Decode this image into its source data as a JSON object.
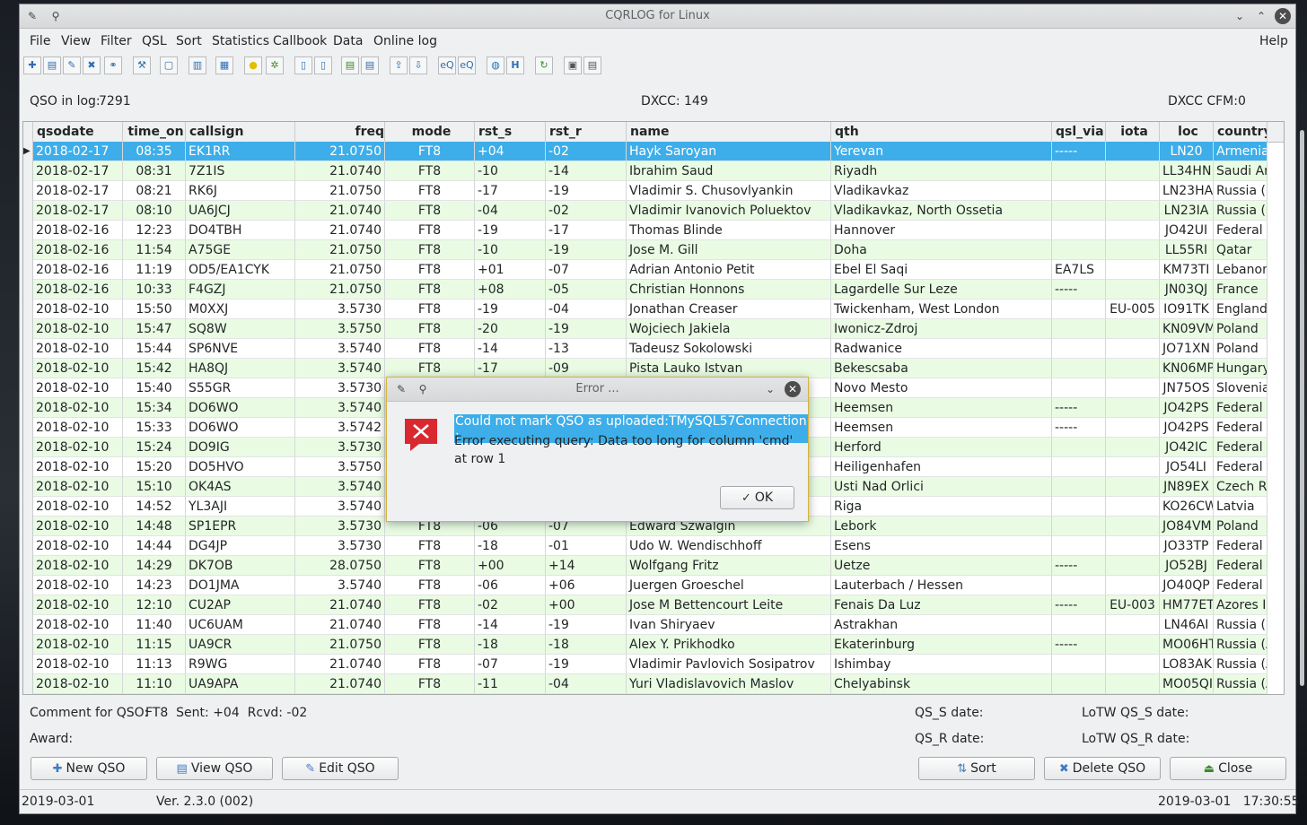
{
  "window": {
    "title": "CQRLOG for Linux"
  },
  "menu": [
    "File",
    "View",
    "Filter",
    "QSL",
    "Sort",
    "Statistics",
    "Callbook",
    "Data",
    "Online log"
  ],
  "menu_help": "Help",
  "stats": {
    "qso_label": "QSO in log:",
    "qso_value": "7291",
    "dxcc_label": "DXCC:",
    "dxcc_value": "149",
    "cfm_label": "DXCC CFM:",
    "cfm_value": "0"
  },
  "columns": [
    "qsodate",
    "time_on",
    "callsign",
    "freq",
    "mode",
    "rst_s",
    "rst_r",
    "name",
    "qth",
    "qsl_via",
    "iota",
    "loc",
    "country"
  ],
  "rows": [
    [
      "2018-02-17",
      "08:35",
      "EK1RR",
      "21.0750",
      "FT8",
      "+04",
      "-02",
      "Hayk Saroyan",
      "Yerevan",
      "-----",
      "",
      "LN20",
      "Armenia"
    ],
    [
      "2018-02-17",
      "08:31",
      "7Z1IS",
      "21.0740",
      "FT8",
      "-10",
      "-14",
      "Ibrahim Saud",
      "Riyadh",
      "",
      "",
      "LL34HN",
      "Saudi Arabia"
    ],
    [
      "2018-02-17",
      "08:21",
      "RK6J",
      "21.0750",
      "FT8",
      "-17",
      "-19",
      "Vladimir S. Chusovlyankin",
      "Vladikavkaz",
      "",
      "",
      "LN23HA",
      "Russia (European)"
    ],
    [
      "2018-02-17",
      "08:10",
      "UA6JCJ",
      "21.0740",
      "FT8",
      "-04",
      "-02",
      "Vladimir Ivanovich Poluektov",
      "Vladikavkaz, North Ossetia",
      "",
      "",
      "LN23IA",
      "Russia (European)"
    ],
    [
      "2018-02-16",
      "12:23",
      "DO4TBH",
      "21.0740",
      "FT8",
      "-19",
      "-17",
      "Thomas Blinde",
      "Hannover",
      "",
      "",
      "JO42UI",
      "Federal Republic of Germany"
    ],
    [
      "2018-02-16",
      "11:54",
      "A75GE",
      "21.0750",
      "FT8",
      "-10",
      "-19",
      "Jose M. Gill",
      "Doha",
      "",
      "",
      "LL55RI",
      "Qatar"
    ],
    [
      "2018-02-16",
      "11:19",
      "OD5/EA1CYK",
      "21.0750",
      "FT8",
      "+01",
      "-07",
      "Adrian Antonio Petit",
      "Ebel El Saqi",
      "EA7LS",
      "",
      "KM73TI",
      "Lebanon"
    ],
    [
      "2018-02-16",
      "10:33",
      "F4GZJ",
      "21.0750",
      "FT8",
      "+08",
      "-05",
      "Christian Honnons",
      "Lagardelle Sur Leze",
      "-----",
      "",
      "JN03QJ",
      "France"
    ],
    [
      "2018-02-10",
      "15:50",
      "M0XXJ",
      "3.5730",
      "FT8",
      "-19",
      "-04",
      "Jonathan Creaser",
      "Twickenham, West London",
      "",
      "EU-005",
      "IO91TK",
      "England"
    ],
    [
      "2018-02-10",
      "15:47",
      "SQ8W",
      "3.5750",
      "FT8",
      "-20",
      "-19",
      "Wojciech Jakiela",
      "Iwonicz-Zdroj",
      "",
      "",
      "KN09VM",
      "Poland"
    ],
    [
      "2018-02-10",
      "15:44",
      "SP6NVE",
      "3.5740",
      "FT8",
      "-14",
      "-13",
      "Tadeusz Sokolowski",
      "Radwanice",
      "",
      "",
      "JO71XN",
      "Poland"
    ],
    [
      "2018-02-10",
      "15:42",
      "HA8QJ",
      "3.5740",
      "FT8",
      "-17",
      "-09",
      "Pista Lauko Istvan",
      "Bekescsaba",
      "",
      "",
      "KN06MP",
      "Hungary"
    ],
    [
      "2018-02-10",
      "15:40",
      "S55GR",
      "3.5730",
      "",
      "",
      "",
      "",
      "Novo Mesto",
      "",
      "",
      "JN75OS",
      "Slovenia"
    ],
    [
      "2018-02-10",
      "15:34",
      "DO6WO",
      "3.5740",
      "",
      "",
      "",
      "",
      "Heemsen",
      "-----",
      "",
      "JO42PS",
      "Federal Republic of Germany"
    ],
    [
      "2018-02-10",
      "15:33",
      "DO6WO",
      "3.5742",
      "",
      "",
      "",
      "",
      "Heemsen",
      "-----",
      "",
      "JO42PS",
      "Federal Republic of Germany"
    ],
    [
      "2018-02-10",
      "15:24",
      "DO9IG",
      "3.5730",
      "",
      "",
      "",
      "",
      "Herford",
      "",
      "",
      "JO42IC",
      "Federal Republic of Germany"
    ],
    [
      "2018-02-10",
      "15:20",
      "DO5HVO",
      "3.5750",
      "",
      "",
      "",
      "",
      "Heiligenhafen",
      "",
      "",
      "JO54LI",
      "Federal Republic of Germany"
    ],
    [
      "2018-02-10",
      "15:10",
      "OK4AS",
      "3.5740",
      "",
      "",
      "",
      "",
      "Usti Nad Orlici",
      "",
      "",
      "JN89EX",
      "Czech Republic"
    ],
    [
      "2018-02-10",
      "14:52",
      "YL3AJI",
      "3.5740",
      "",
      "",
      "",
      "",
      "Riga",
      "",
      "",
      "KO26CW",
      "Latvia"
    ],
    [
      "2018-02-10",
      "14:48",
      "SP1EPR",
      "3.5730",
      "FT8",
      "-06",
      "-07",
      "Edward Szwalgin",
      "Lebork",
      "",
      "",
      "JO84VM",
      "Poland"
    ],
    [
      "2018-02-10",
      "14:44",
      "DG4JP",
      "3.5730",
      "FT8",
      "-18",
      "-01",
      "Udo W. Wendischhoff",
      "Esens",
      "",
      "",
      "JO33TP",
      "Federal Republic of Germany"
    ],
    [
      "2018-02-10",
      "14:29",
      "DK7OB",
      "28.0750",
      "FT8",
      "+00",
      "+14",
      "Wolfgang Fritz",
      "Uetze",
      "-----",
      "",
      "JO52BJ",
      "Federal Republic of Germany"
    ],
    [
      "2018-02-10",
      "14:23",
      "DO1JMA",
      "3.5740",
      "FT8",
      "-06",
      "+06",
      "Juergen Groeschel",
      "Lauterbach / Hessen",
      "",
      "",
      "JO40QP",
      "Federal Republic of Germany"
    ],
    [
      "2018-02-10",
      "12:10",
      "CU2AP",
      "21.0740",
      "FT8",
      "-02",
      "+00",
      "Jose M Bettencourt Leite",
      "Fenais Da Luz",
      "-----",
      "EU-003",
      "HM77ET",
      "Azores Islands"
    ],
    [
      "2018-02-10",
      "11:40",
      "UC6UAM",
      "21.0740",
      "FT8",
      "-14",
      "-19",
      "Ivan Shiryaev",
      "Astrakhan",
      "",
      "",
      "LN46AI",
      "Russia (European)"
    ],
    [
      "2018-02-10",
      "11:15",
      "UA9CR",
      "21.0750",
      "FT8",
      "-18",
      "-18",
      "Alex Y.  Prikhodko",
      "Ekaterinburg",
      "-----",
      "",
      "MO06HT",
      "Russia (Asiatic)"
    ],
    [
      "2018-02-10",
      "11:13",
      "R9WG",
      "21.0740",
      "FT8",
      "-07",
      "-19",
      "Vladimir Pavlovich Sosipatrov",
      "Ishimbay",
      "",
      "",
      "LO83AK",
      "Russia (Asiatic)"
    ],
    [
      "2018-02-10",
      "11:10",
      "UA9APA",
      "21.0740",
      "FT8",
      "-11",
      "-04",
      "Yuri Vladislavovich Maslov",
      "Chelyabinsk",
      "",
      "",
      "MO05QI",
      "Russia (Asiatic)"
    ]
  ],
  "detail": {
    "comment_label": "Comment for QSO:",
    "comment_value": "FT8  Sent: +04  Rcvd: -02",
    "award_label": "Award:",
    "qs_s_label": "QS_S date:",
    "qs_r_label": "QS_R date:",
    "lotw_s_label": "LoTW QS_S date:",
    "lotw_r_label": "LoTW QS_R date:"
  },
  "buttons": {
    "new_qso": "New QSO",
    "view_qso": "View QSO",
    "edit_qso": "Edit QSO",
    "sort": "Sort",
    "delete_qso": "Delete QSO",
    "close": "Close"
  },
  "status": {
    "date": "2019-03-01",
    "version": "Ver. 2.3.0 (002)",
    "datetime": "2019-03-01   17:30:55"
  },
  "dialog": {
    "title": "Error ...",
    "line1": "Could not mark QSO as uploaded:TMySQL57Connection :",
    "line2": "Error executing query: Data too long for column 'cmd' at row 1",
    "ok": "OK"
  },
  "colors": {
    "selection": "#3daee9",
    "row_alt": "#e9fce3",
    "error_icon": "#d9282f"
  }
}
